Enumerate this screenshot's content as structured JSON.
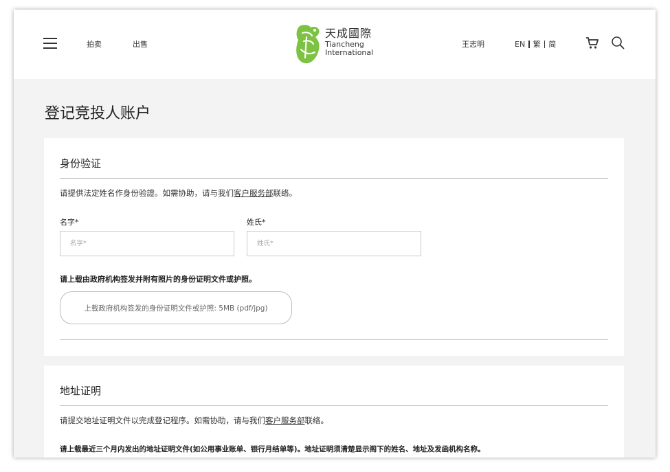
{
  "header": {
    "nav": [
      "拍卖",
      "出售"
    ],
    "logo": {
      "cn": "天成國際",
      "en_line1": "Tiancheng",
      "en_line2": "International"
    },
    "user_name": "王志明",
    "languages": [
      "EN",
      "繁",
      "简"
    ]
  },
  "page_title": "登记竞投人账户",
  "identity": {
    "title": "身份验证",
    "desc_prefix": "请提供法定姓名作身份验證。如需协助，请与我们",
    "desc_link": "客户服务部",
    "desc_suffix": "联络。",
    "first_name_label": "名字*",
    "first_name_placeholder": "名字*",
    "last_name_label": "姓氏*",
    "last_name_placeholder": "姓氏*",
    "upload_instruction": "请上载由政府机构签发并附有照片的身份证明文件或护照。",
    "upload_button": "上载政府机构签发的身份证明文件或护照: 5MB (pdf/jpg)"
  },
  "address": {
    "title": "地址证明",
    "desc_prefix": "请提交地址证明文件以完成登记程序。如需协助，请与我们",
    "desc_link": "客户服务部",
    "desc_suffix": "联络。",
    "instruction": "请上载最近三个月内发出的地址证明文件(如公用事业账单、银行月结单等)。地址证明须清楚显示阁下的姓名、地址及发函机构名称。"
  },
  "colors": {
    "logo_green": "#7dc242",
    "rule": "#bdbdbd",
    "page_bg": "#f3f3f3"
  },
  "icons": [
    "menu-icon",
    "cart-icon",
    "search-icon",
    "logo-mark-icon"
  ]
}
